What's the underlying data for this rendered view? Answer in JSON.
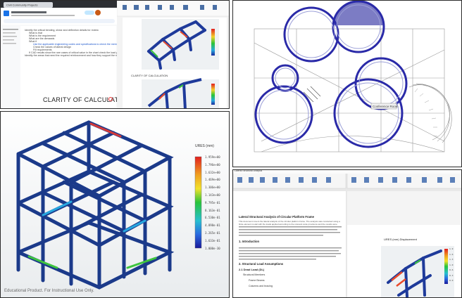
{
  "top_left": {
    "browser_tab_title": "Civil Community Projects",
    "doc_outline": [
      "Identify the critical bending, shear and deflection details for review",
      "What is that",
      "What is the requirement",
      "What are the demands",
      "What if",
      "Use the applicable engineering codes and specifications to check the members",
      "Check the values of lateral design",
      "Fill requirements",
      "If CAD results show the rare cases of critical value in the chart check the load path",
      "Identify the areas that need the required reinforcement and how they support the remaining design"
    ],
    "heading": "CLARITY OF CALCULATION",
    "caption": "CLARITY OF CALCULATION"
  },
  "structure_panel": {
    "legend_title": "URES (mm)",
    "legend_values": [
      "1.959e+00",
      "1.796e+00",
      "1.632e+00",
      "1.469e+00",
      "1.306e+00",
      "1.143e+00",
      "9.795e-01",
      "8.163e-01",
      "6.530e-01",
      "4.898e-01",
      "3.265e-01",
      "1.633e-01",
      "1.000e-30"
    ],
    "watermark": "Educational Product. For Instructional Use Only.",
    "colors": {
      "frame": "#1b3a8a",
      "high": "#e02020",
      "mid": "#18c030",
      "low": "#1a2a9a"
    }
  },
  "top_right": {
    "plan_label": "Conference Room",
    "circle_highlight_color": "#2a2aa8"
  },
  "bottom_right": {
    "word_title": "Lateral Structural Analysis",
    "doc_heading": "Lateral Structural Analysis of Circular Platform Frame",
    "section_1": "1. Introduction",
    "section_2": "2. Structural Load Assumptions",
    "section_2_1": "2.1 Dead Load (DL)",
    "bullets": [
      "Structural Members",
      "Frame Beams",
      "Columns and bracing"
    ],
    "paragraph": "This document covers the lateral analysis of the circular platform frame. The analysis was conducted using a finite element model with the loads applied according to the relevant code provisions and the results were verified against hand calculations for the critical members in the frame.",
    "chart_caption": "URES (mm) Displacement",
    "legend_values": [
      "1.9",
      "1.6",
      "1.3",
      "1.0",
      "0.6",
      "0.3",
      "0.0"
    ]
  }
}
